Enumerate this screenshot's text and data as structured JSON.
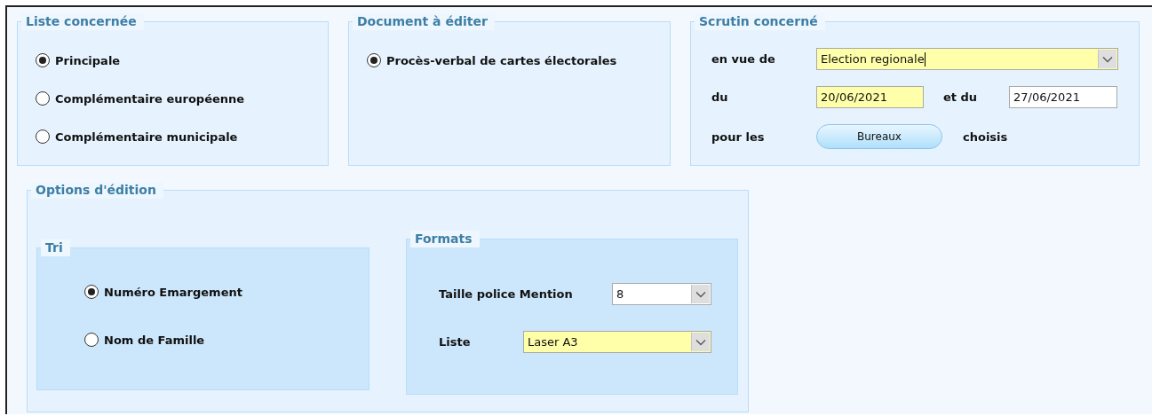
{
  "groups": [
    {
      "kind": "radios",
      "title": "Liste concernée",
      "options": [
        {
          "label": "Principale",
          "selected": true
        },
        {
          "label": "Complémentaire européenne",
          "selected": false
        },
        {
          "label": "Complémentaire municipale",
          "selected": false
        }
      ]
    },
    {
      "kind": "radios",
      "title": "Document à éditer",
      "options": [
        {
          "label": "Procès-verbal de cartes électorales",
          "selected": true
        }
      ]
    },
    {
      "kind": "scrutin",
      "title": "Scrutin concerné",
      "en_vue_de": {
        "label": "en vue de",
        "value": "Election regionale",
        "highlighted": true,
        "focused": true
      },
      "du": {
        "label": "du",
        "value": "20/06/2021",
        "highlighted": true
      },
      "et_du": {
        "label": "et du",
        "value": "27/06/2021",
        "highlighted": false
      },
      "pour_les": {
        "label": "pour les",
        "button": "Bureaux",
        "suffix": "choisis"
      }
    }
  ],
  "options": {
    "title": "Options d'édition",
    "tri": {
      "title": "Tri",
      "options": [
        {
          "label": "Numéro Emargement",
          "selected": true
        },
        {
          "label": "Nom de Famille",
          "selected": false
        }
      ]
    },
    "formats": {
      "title": "Formats",
      "rows": [
        {
          "label": "Taille police Mention",
          "value": "8",
          "highlighted": false
        },
        {
          "label": "Liste",
          "value": "Laser A3",
          "highlighted": true
        }
      ]
    }
  }
}
